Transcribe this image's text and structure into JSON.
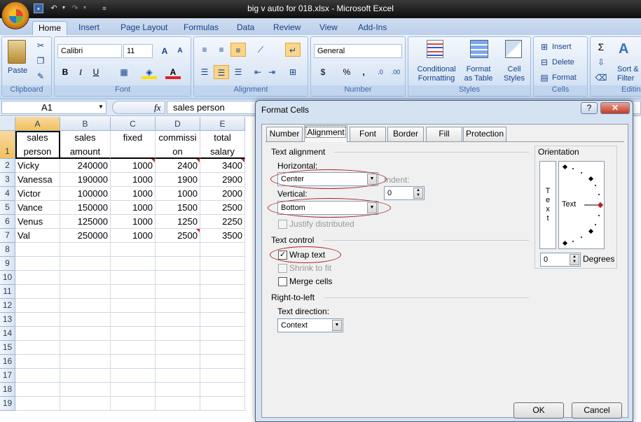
{
  "window": {
    "title": "big v auto for 018.xlsx - Microsoft Excel"
  },
  "ribbon": {
    "tabs": [
      "Home",
      "Insert",
      "Page Layout",
      "Formulas",
      "Data",
      "Review",
      "View",
      "Add-Ins"
    ],
    "clipboard": {
      "label": "Clipboard",
      "paste": "Paste"
    },
    "font": {
      "label": "Font",
      "name": "Calibri",
      "size": "11",
      "bold": "B",
      "italic": "I",
      "underline": "U"
    },
    "alignment": {
      "label": "Alignment"
    },
    "number": {
      "label": "Number",
      "format": "General",
      "currency": "$",
      "percent": "%",
      "comma": ","
    },
    "styles": {
      "label": "Styles",
      "conditional": "Conditional",
      "conditional2": "Formatting",
      "format_table": "Format",
      "format_table2": "as Table",
      "cell_styles": "Cell",
      "cell_styles2": "Styles"
    },
    "cells": {
      "label": "Cells",
      "insert": "Insert",
      "delete": "Delete",
      "format": "Format"
    },
    "editing": {
      "label": "Editin",
      "sort": "Sort &",
      "filter": "Filter"
    }
  },
  "formula_bar": {
    "name_box": "A1",
    "fx": "fx",
    "content": "sales person"
  },
  "sheet": {
    "columns": [
      "A",
      "B",
      "C",
      "D",
      "E"
    ],
    "rows": [
      "1",
      "2",
      "3",
      "4",
      "5",
      "6",
      "7",
      "8",
      "9",
      "10",
      "11",
      "12",
      "13",
      "14",
      "15",
      "16",
      "17",
      "18",
      "19"
    ],
    "header": [
      [
        "sales",
        "person"
      ],
      [
        "sales",
        "amount"
      ],
      [
        "",
        "fixed"
      ],
      [
        "commissi",
        "on"
      ],
      [
        "total",
        "salary"
      ]
    ],
    "data": [
      [
        "Vicky",
        "240000",
        "1000",
        "2400",
        "3400"
      ],
      [
        "Vanessa",
        "190000",
        "1000",
        "1900",
        "2900"
      ],
      [
        "Victor",
        "100000",
        "1000",
        "1000",
        "2000"
      ],
      [
        "Vance",
        "150000",
        "1000",
        "1500",
        "2500"
      ],
      [
        "Venus",
        "125000",
        "1000",
        "1250",
        "2250"
      ],
      [
        "Val",
        "250000",
        "1000",
        "2500",
        "3500"
      ]
    ]
  },
  "dialog": {
    "title": "Format Cells",
    "help": "?",
    "close": "✕",
    "tabs": [
      "Number",
      "Alignment",
      "Font",
      "Border",
      "Fill",
      "Protection"
    ],
    "text_alignment": "Text alignment",
    "horizontal_label": "Horizontal:",
    "horizontal_value": "Center",
    "indent_label": "Indent:",
    "indent_value": "0",
    "vertical_label": "Vertical:",
    "vertical_value": "Bottom",
    "justify_distributed": "Justify distributed",
    "text_control": "Text control",
    "wrap_text": "Wrap text",
    "shrink_to_fit": "Shrink to fit",
    "merge_cells": "Merge cells",
    "rtl": "Right-to-left",
    "text_direction_label": "Text direction:",
    "text_direction_value": "Context",
    "orientation": "Orientation",
    "vertical_text": [
      "T",
      "e",
      "x",
      "t"
    ],
    "dial_text": "Text",
    "degrees_value": "0",
    "degrees_label": "Degrees",
    "ok": "OK",
    "cancel": "Cancel"
  }
}
